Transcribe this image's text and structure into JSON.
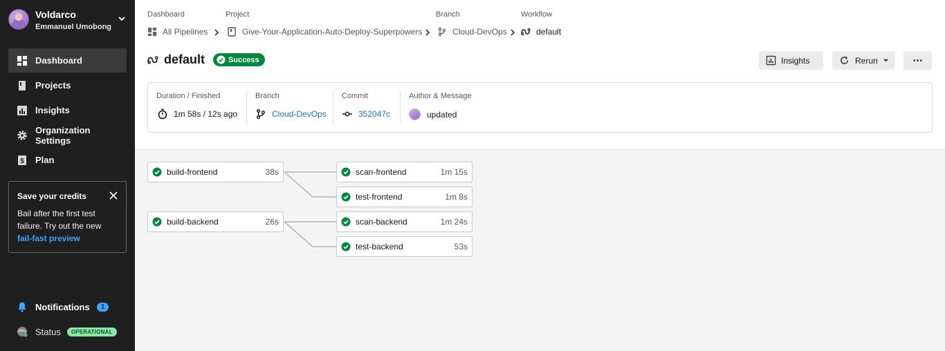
{
  "account": {
    "org": "Voldarco",
    "user": "Emmanuel Umobong"
  },
  "nav": [
    {
      "label": "Dashboard",
      "icon": "dashboard-icon",
      "active": true
    },
    {
      "label": "Projects",
      "icon": "book-icon"
    },
    {
      "label": "Insights",
      "icon": "bar-chart-icon"
    },
    {
      "label": "Organization Settings",
      "icon": "gear-icon"
    },
    {
      "label": "Plan",
      "icon": "dollar-icon"
    }
  ],
  "promo": {
    "title": "Save your credits",
    "body": "Bail after the first test failure. Try out the new",
    "link": "fail-fast preview"
  },
  "notifications": {
    "label": "Notifications",
    "count": "1"
  },
  "status": {
    "label": "Status",
    "badge": "OPERATIONAL"
  },
  "breadcrumbs": {
    "dashboard_label": "Dashboard",
    "dashboard_value": "All Pipelines",
    "project_label": "Project",
    "project_value": "Give-Your-Application-Auto-Deploy-Superpowers",
    "branch_label": "Branch",
    "branch_value": "Cloud-DevOps",
    "workflow_label": "Workflow",
    "workflow_value": "default"
  },
  "header": {
    "title": "default",
    "status": "Success"
  },
  "buttons": {
    "insights": "Insights",
    "rerun": "Rerun"
  },
  "summary": {
    "duration_label": "Duration / Finished",
    "duration_value": "1m 58s / 12s ago",
    "branch_label": "Branch",
    "branch_value": "Cloud-DevOps",
    "commit_label": "Commit",
    "commit_value": "352047c",
    "author_label": "Author & Message",
    "author_value": "updated"
  },
  "jobs": [
    {
      "name": "build-frontend",
      "duration": "38s"
    },
    {
      "name": "scan-frontend",
      "duration": "1m 15s"
    },
    {
      "name": "test-frontend",
      "duration": "1m 8s"
    },
    {
      "name": "build-backend",
      "duration": "26s"
    },
    {
      "name": "scan-backend",
      "duration": "1m 24s"
    },
    {
      "name": "test-backend",
      "duration": "53s"
    }
  ],
  "colors": {
    "success": "#00883b",
    "link": "#1a6fd1",
    "sidebar": "#1f1f1f"
  }
}
